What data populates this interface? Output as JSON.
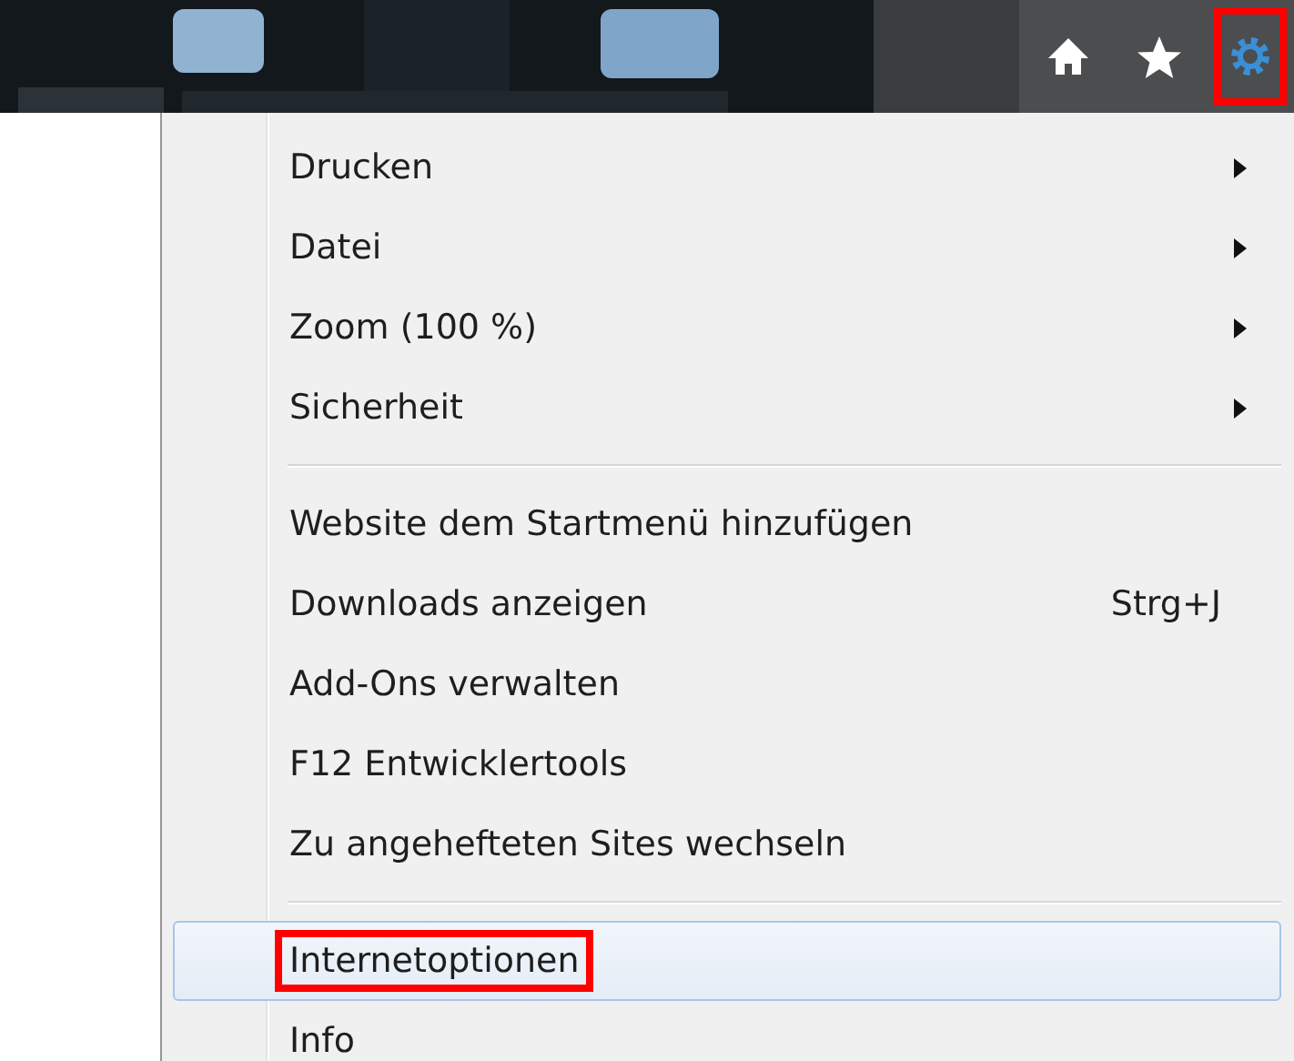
{
  "toolbar": {
    "icons": [
      {
        "kind": "home",
        "annotated": false
      },
      {
        "kind": "star",
        "annotated": false
      },
      {
        "kind": "gear",
        "annotated": true
      }
    ]
  },
  "menu": {
    "groups": [
      [
        {
          "label": "Drucken",
          "submenu": true,
          "selected": false,
          "annotated": false
        },
        {
          "label": "Datei",
          "submenu": true,
          "selected": false,
          "annotated": false
        },
        {
          "label": "Zoom (100 %)",
          "submenu": true,
          "selected": false,
          "annotated": false
        },
        {
          "label": "Sicherheit",
          "submenu": true,
          "selected": false,
          "annotated": false
        }
      ],
      [
        {
          "label": "Website dem Startmenü hinzufügen",
          "submenu": false,
          "selected": false,
          "annotated": false
        },
        {
          "label": "Downloads anzeigen",
          "shortcut": "Strg+J",
          "submenu": false,
          "selected": false,
          "annotated": false
        },
        {
          "label": "Add-Ons verwalten",
          "submenu": false,
          "selected": false,
          "annotated": false
        },
        {
          "label": "F12 Entwicklertools",
          "submenu": false,
          "selected": false,
          "annotated": false
        },
        {
          "label": "Zu angehefteten Sites wechseln",
          "submenu": false,
          "selected": false,
          "annotated": false
        }
      ],
      [
        {
          "label": "Internetoptionen",
          "submenu": false,
          "selected": true,
          "annotated": true
        },
        {
          "label": "Info",
          "submenu": false,
          "selected": false,
          "annotated": false
        }
      ]
    ]
  }
}
